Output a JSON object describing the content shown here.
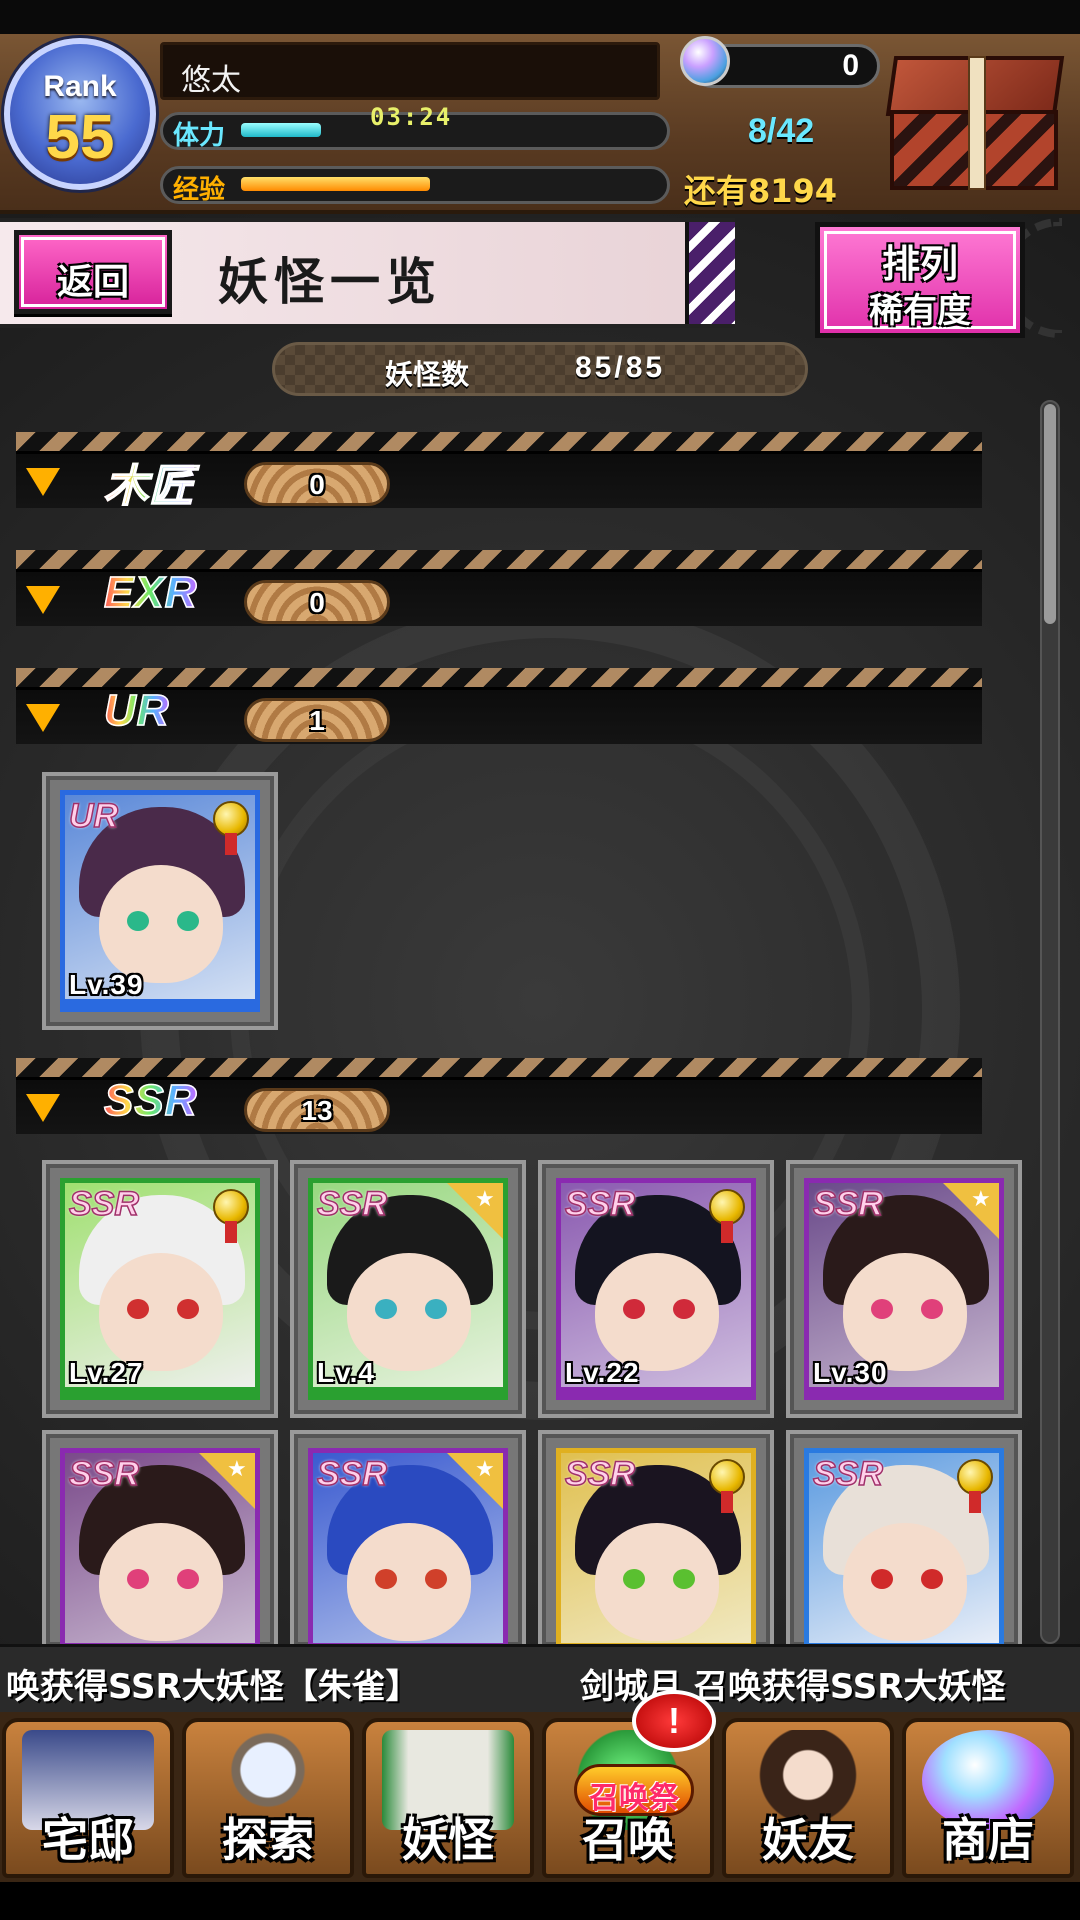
{
  "player": {
    "rank_label": "Rank",
    "rank": "55",
    "name": "悠太",
    "stamina_label": "体力",
    "stamina_timer": "03:24",
    "stamina_value": "8/42",
    "stamina_fill": 0.19,
    "exp_label": "经验",
    "exp_remaining": "还有8194",
    "exp_fill": 0.45,
    "gems": "0"
  },
  "titlebar": {
    "back_label": "返回",
    "title": "妖怪一览",
    "sort_label": "排列",
    "sort_value": "稀有度"
  },
  "summary": {
    "label": "妖怪数",
    "value": "85/85"
  },
  "sections": [
    {
      "rarity": "木匠",
      "count": "0"
    },
    {
      "rarity": "EXR",
      "count": "0"
    },
    {
      "rarity": "UR",
      "count": "1"
    },
    {
      "rarity": "SSR",
      "count": "13"
    }
  ],
  "cards": {
    "ur": [
      {
        "badge": "UR",
        "level": "Lv.39",
        "medal": true
      }
    ],
    "ssr": [
      {
        "badge": "SSR",
        "level": "Lv.27",
        "medal": true
      },
      {
        "badge": "SSR",
        "level": "Lv.4",
        "medal": false
      },
      {
        "badge": "SSR",
        "level": "Lv.22",
        "medal": true
      },
      {
        "badge": "SSR",
        "level": "Lv.30",
        "medal": false
      },
      {
        "badge": "SSR",
        "level": "",
        "medal": false
      },
      {
        "badge": "SSR",
        "level": "",
        "medal": false
      },
      {
        "badge": "SSR",
        "level": "",
        "medal": true
      },
      {
        "badge": "SSR",
        "level": "",
        "medal": true
      }
    ]
  },
  "ticker": {
    "text1": "唤获得SSR大妖怪【朱雀】",
    "text2": "剑城月 召唤获得SSR大妖怪"
  },
  "nav": {
    "items": [
      {
        "label": "宅邸",
        "icon": "mansion-icon"
      },
      {
        "label": "探索",
        "icon": "magnifier-icon"
      },
      {
        "label": "妖怪",
        "icon": "scroll-icon"
      },
      {
        "label": "召唤",
        "icon": "summon-star-icon"
      },
      {
        "label": "妖友",
        "icon": "friend-catgirl-icon"
      },
      {
        "label": "商店",
        "icon": "crystal-orb-icon"
      }
    ],
    "summon_tag": "召唤祭",
    "alert": "!"
  },
  "colors": {
    "accent_pink": "#e030aa",
    "stamina": "#6ae8ff",
    "exp": "#ffb000",
    "gold": "#ffd84a"
  }
}
